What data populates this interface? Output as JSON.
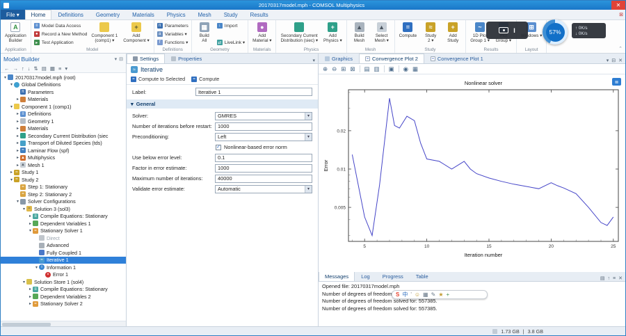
{
  "title_bar": {
    "title": "20170317model.mph - COMSOL Multiphysics",
    "close": "✕"
  },
  "menu": {
    "file_label": "File ▾",
    "tabs": [
      "Home",
      "Definitions",
      "Geometry",
      "Materials",
      "Physics",
      "Mesh",
      "Study",
      "Results"
    ],
    "active_tab": "Home"
  },
  "ribbon": {
    "groups": [
      {
        "label": "Application",
        "items": [
          {
            "type": "big",
            "icon": "app-builder",
            "label": "Application\nBuilder"
          }
        ]
      },
      {
        "label": "Model",
        "items": [
          {
            "type": "small",
            "icon": "model-data",
            "label": "Model Data Access"
          },
          {
            "type": "small",
            "icon": "record",
            "label": "Record a New Method"
          },
          {
            "type": "small",
            "icon": "test-app",
            "label": "Test Application"
          },
          {
            "type": "big",
            "icon": "component",
            "label": "Component 1\n(comp1)",
            "caret": true
          },
          {
            "type": "big",
            "icon": "add-component",
            "label": "Add\nComponent",
            "caret": true
          }
        ]
      },
      {
        "label": "Definitions",
        "items": [
          {
            "type": "small",
            "icon": "pi",
            "label": "Parameters"
          },
          {
            "type": "small",
            "icon": "variables",
            "label": "Variables",
            "caret": true
          },
          {
            "type": "small",
            "icon": "functions",
            "label": "Functions",
            "caret": true
          }
        ]
      },
      {
        "label": "Geometry",
        "items": [
          {
            "type": "big",
            "icon": "build-all",
            "label": "Build\nAll"
          },
          {
            "type": "small",
            "icon": "import",
            "label": "Import"
          },
          {
            "type": "small",
            "icon": "livelink",
            "label": "LiveLink",
            "caret": true
          }
        ]
      },
      {
        "label": "Materials",
        "items": [
          {
            "type": "big",
            "icon": "add-material",
            "label": "Add\nMaterial",
            "caret": true
          }
        ]
      },
      {
        "label": "Physics",
        "items": [
          {
            "type": "big",
            "icon": "siec",
            "label": "Secondary Current\nDistribution (siec)",
            "caret": true
          },
          {
            "type": "big",
            "icon": "add-physics",
            "label": "Add\nPhysics",
            "caret": true
          }
        ]
      },
      {
        "label": "Mesh",
        "items": [
          {
            "type": "big",
            "icon": "build-mesh",
            "label": "Build\nMesh"
          },
          {
            "type": "big",
            "icon": "select-mesh",
            "label": "Select\nMesh",
            "caret": true
          }
        ]
      },
      {
        "label": "Study",
        "items": [
          {
            "type": "big",
            "icon": "compute",
            "label": "Compute"
          },
          {
            "type": "big",
            "icon": "study",
            "label": "Study\n2",
            "caret": true
          },
          {
            "type": "big",
            "icon": "add-study",
            "label": "Add\nStudy"
          }
        ]
      },
      {
        "label": "Results",
        "items": [
          {
            "type": "big",
            "icon": "plot-group",
            "label": "1D Plot\nGroup 1",
            "caret": true
          },
          {
            "type": "big",
            "icon": "plot-group2",
            "label": "Plot\nGroup",
            "caret": true
          }
        ]
      },
      {
        "label": "Layout",
        "items": [
          {
            "type": "big",
            "icon": "windows",
            "label": "Windows",
            "caret": true
          }
        ]
      }
    ]
  },
  "model_builder": {
    "header": "Model Builder",
    "toolbar_icons": [
      "←",
      "→",
      "↑",
      "↓",
      "⇅",
      "▤",
      "▦",
      "≡",
      "▾"
    ],
    "items": [
      {
        "label": "20170317model.mph (root)",
        "indent": 0,
        "arrow": "exp",
        "icon": "model-root"
      },
      {
        "label": "Global Definitions",
        "indent": 1,
        "arrow": "exp",
        "icon": "globe"
      },
      {
        "label": "Parameters",
        "indent": 2,
        "arrow": "none",
        "icon": "pi"
      },
      {
        "label": "Materials",
        "indent": 2,
        "arrow": "col",
        "icon": "materials"
      },
      {
        "label": "Component 1 (comp1)",
        "indent": 1,
        "arrow": "exp",
        "icon": "component"
      },
      {
        "label": "Definitions",
        "indent": 2,
        "arrow": "col",
        "icon": "definitions"
      },
      {
        "label": "Geometry 1",
        "indent": 2,
        "arrow": "col",
        "icon": "geometry"
      },
      {
        "label": "Materials",
        "indent": 2,
        "arrow": "col",
        "icon": "materials"
      },
      {
        "label": "Secondary Current Distribution (siec",
        "indent": 2,
        "arrow": "col",
        "icon": "siec"
      },
      {
        "label": "Transport of Diluted Species (tds)",
        "indent": 2,
        "arrow": "col",
        "icon": "tds"
      },
      {
        "label": "Laminar Flow (spf)",
        "indent": 2,
        "arrow": "col",
        "icon": "spf"
      },
      {
        "label": "Multiphysics",
        "indent": 2,
        "arrow": "col",
        "icon": "multiphysics"
      },
      {
        "label": "Mesh 1",
        "indent": 2,
        "arrow": "col",
        "icon": "mesh"
      },
      {
        "label": "Study 1",
        "indent": 1,
        "arrow": "col",
        "icon": "study"
      },
      {
        "label": "Study 2",
        "indent": 1,
        "arrow": "exp",
        "icon": "study"
      },
      {
        "label": "Step 1: Stationary",
        "indent": 2,
        "arrow": "none",
        "icon": "step"
      },
      {
        "label": "Step 2: Stationary 2",
        "indent": 2,
        "arrow": "none",
        "icon": "step"
      },
      {
        "label": "Solver Configurations",
        "indent": 2,
        "arrow": "exp",
        "icon": "solverconf"
      },
      {
        "label": "Solution 3 (sol3)",
        "indent": 3,
        "arrow": "exp",
        "icon": "solution"
      },
      {
        "label": "Compile Equations: Stationary",
        "indent": 4,
        "arrow": "col",
        "icon": "compile"
      },
      {
        "label": "Dependent Variables 1",
        "indent": 4,
        "arrow": "col",
        "icon": "depvar"
      },
      {
        "label": "Stationary Solver 1",
        "indent": 4,
        "arrow": "exp",
        "icon": "statsolver"
      },
      {
        "label": "Direct",
        "indent": 5,
        "arrow": "none",
        "icon": "direct",
        "dim": true
      },
      {
        "label": "Advanced",
        "indent": 5,
        "arrow": "none",
        "icon": "advanced"
      },
      {
        "label": "Fully Coupled 1",
        "indent": 5,
        "arrow": "none",
        "icon": "fullycoupled"
      },
      {
        "label": "Iterative 1",
        "indent": 5,
        "arrow": "none",
        "icon": "iterative",
        "selected": true
      },
      {
        "label": "Information 1",
        "indent": 5,
        "arrow": "exp",
        "icon": "info"
      },
      {
        "label": "Error 1",
        "indent": 6,
        "arrow": "none",
        "icon": "error"
      },
      {
        "label": "Solution Store 1 (sol4)",
        "indent": 3,
        "arrow": "exp",
        "icon": "solstore"
      },
      {
        "label": "Compile Equations: Stationary",
        "indent": 4,
        "arrow": "col",
        "icon": "compile"
      },
      {
        "label": "Dependent Variables 2",
        "indent": 4,
        "arrow": "col",
        "icon": "depvar"
      },
      {
        "label": "Stationary Solver 2",
        "indent": 4,
        "arrow": "col",
        "icon": "statsolver"
      }
    ]
  },
  "settings": {
    "tabs": [
      "Settings",
      "Properties"
    ],
    "active_tab": "Settings",
    "title": "Iterative",
    "toolbar": {
      "compute_to_selected": "Compute to Selected",
      "compute": "Compute"
    },
    "label_field": {
      "label": "Label:",
      "value": "Iterative 1"
    },
    "section_general": "General",
    "fields": [
      {
        "label": "Solver:",
        "type": "combo",
        "value": "GMRES"
      },
      {
        "label": "Number of iterations before restart:",
        "type": "input",
        "value": "1000"
      },
      {
        "label": "Preconditioning:",
        "type": "combo",
        "value": "Left"
      },
      {
        "label": "Nonlinear-based error norm",
        "type": "checkbox",
        "checked": true
      },
      {
        "label": "Use below error level:",
        "type": "input",
        "value": "0.1"
      },
      {
        "label": "Factor in error estimate:",
        "type": "input",
        "value": "1000"
      },
      {
        "label": "Maximum number of iterations:",
        "type": "input",
        "value": "40000"
      },
      {
        "label": "Validate error estimate:",
        "type": "combo",
        "value": "Automatic"
      }
    ]
  },
  "graphics": {
    "tabs": [
      {
        "label": "Graphics",
        "icon": "graphics-tab"
      },
      {
        "label": "Convergence Plot 2",
        "icon": "conv-tab"
      },
      {
        "label": "Convergence Plot 1",
        "icon": "conv-tab"
      }
    ],
    "active_tab": "Convergence Plot 2",
    "strip_icons": [
      "▾",
      "⊟",
      "✕"
    ],
    "toolbar_icons": [
      "⊕",
      "⊖",
      "⊞",
      "⊠",
      "|",
      "▤",
      "▥",
      "|",
      "▣",
      "|",
      "◉",
      "▦"
    ]
  },
  "chart_data": {
    "type": "line",
    "title": "Nonlinear solver",
    "xlabel": "Iteration number",
    "ylabel": "Error",
    "x_ticks": [
      5,
      10,
      15,
      20,
      25
    ],
    "y_ticks": [
      0.02,
      0.01,
      0.005
    ],
    "y_scale": "log",
    "x_range": [
      3.7,
      25.4
    ],
    "y_range": [
      0.0027,
      0.042
    ],
    "grid": false,
    "legend": "none",
    "line_color": "#4545c8",
    "x": [
      4,
      5,
      5.6,
      6.2,
      7,
      7.4,
      7.8,
      8.4,
      9,
      9.5,
      10,
      11,
      12,
      13,
      13.5,
      14,
      15,
      16,
      17,
      18,
      19,
      20,
      20.5,
      21,
      22,
      23,
      24,
      24.5,
      25
    ],
    "y": [
      0.013,
      0.0042,
      0.003,
      0.0075,
      0.036,
      0.022,
      0.021,
      0.026,
      0.024,
      0.016,
      0.012,
      0.0115,
      0.01,
      0.0115,
      0.01,
      0.0092,
      0.0085,
      0.008,
      0.0076,
      0.0073,
      0.007,
      0.0078,
      0.0074,
      0.0071,
      0.0064,
      0.005,
      0.0038,
      0.0036,
      0.0042
    ]
  },
  "messages": {
    "tabs": [
      "Messages",
      "Log",
      "Progress",
      "Table"
    ],
    "active_tab": "Messages",
    "strip_icons": [
      "▤",
      "↑",
      "≡",
      "✕"
    ],
    "lines": [
      "Opened file: 20170317model.mph",
      "Number of degrees of freedom solved for: 557385.",
      "Number of degrees of freedom solved for: 557385.",
      "Number of degrees of freedom solved for: 557385."
    ]
  },
  "status_bar": {
    "memory_physical": "1.73 GB",
    "separator": "|",
    "memory_virtual": "3.8 GB"
  },
  "overlay": {
    "recorder_label": "I",
    "gauge_percent": "57%",
    "net_up": "↑ 0K/s",
    "net_down": "↓ 0K/s",
    "sogou": [
      {
        "glyph": "S",
        "color": "#e8442f"
      },
      {
        "glyph": "中",
        "color": "#2f6fc0"
      },
      {
        "glyph": "'",
        "color": "#888888"
      },
      {
        "glyph": "☺",
        "color": "#c09a2f"
      },
      {
        "glyph": "▦",
        "color": "#6a7a8a"
      },
      {
        "glyph": "✎",
        "color": "#6a7a8a"
      },
      {
        "glyph": "★",
        "color": "#c09a2f"
      },
      {
        "glyph": "+",
        "color": "#3f8f4f"
      }
    ]
  },
  "icons": {
    "app-builder": {
      "glyph": "A",
      "bg": "#ffffff",
      "fg": "#2f8f3f",
      "border": true
    },
    "model-data": {
      "glyph": "≡",
      "bg": "#5b8fd0"
    },
    "record": {
      "glyph": "●",
      "bg": "#c03a3a"
    },
    "test-app": {
      "glyph": "▸",
      "bg": "#3f8f4f"
    },
    "component": {
      "bg": "#ecc94b"
    },
    "add-component": {
      "glyph": "+",
      "bg": "#ecc94b",
      "fg": "#553"
    },
    "pi": {
      "glyph": "π",
      "bg": "#3a6fb0"
    },
    "variables": {
      "glyph": "a",
      "bg": "#6a8fc0"
    },
    "functions": {
      "glyph": "f",
      "bg": "#7a9ad0"
    },
    "build-all": {
      "glyph": "▦",
      "bg": "#8fa3b8"
    },
    "import": {
      "glyph": "↓",
      "bg": "#4a86c8"
    },
    "livelink": {
      "glyph": "⇄",
      "bg": "#3fa0a0"
    },
    "add-material": {
      "glyph": "●",
      "bg": "#b06ac0"
    },
    "siec": {
      "bg": "#2fa089"
    },
    "add-physics": {
      "glyph": "+",
      "bg": "#2fa089"
    },
    "build-mesh": {
      "glyph": "▲",
      "bg": "#aab4be",
      "fg": "#4a5560"
    },
    "select-mesh": {
      "glyph": "▲",
      "bg": "#c8d0d8",
      "fg": "#4a5560"
    },
    "compute": {
      "glyph": "=",
      "bg": "#2f6fc0"
    },
    "study": {
      "glyph": "≈",
      "bg": "#c9a227"
    },
    "add-study": {
      "glyph": "+",
      "bg": "#c9a227"
    },
    "plot-group": {
      "glyph": "~",
      "bg": "#4a86c8"
    },
    "plot-group2": {
      "glyph": "~",
      "bg": "#4a86c8"
    },
    "windows": {
      "glyph": "⊞",
      "bg": "#5b8fd0"
    },
    "model-root": {
      "bg": "#4a86c8"
    },
    "globe": {
      "bg": "#3fa0d0",
      "round": true
    },
    "materials": {
      "bg": "#cf7f3a"
    },
    "definitions": {
      "glyph": "≡",
      "bg": "#5b8fd0"
    },
    "geometry": {
      "bg": "#b5bdc6"
    },
    "tds": {
      "bg": "#46a0c8"
    },
    "spf": {
      "glyph": "≈",
      "bg": "#3f7fc0"
    },
    "multiphysics": {
      "glyph": "▲",
      "bg": "#d06f2f"
    },
    "mesh": {
      "glyph": "▲",
      "bg": "#c8cfd6",
      "fg": "#5a6570"
    },
    "step": {
      "glyph": "=",
      "bg": "#d9a440"
    },
    "solverconf": {
      "bg": "#8898a8"
    },
    "solution": {
      "glyph": "=",
      "bg": "#e0b84a",
      "fg": "#665"
    },
    "compile": {
      "glyph": "≡",
      "bg": "#4aa8a0"
    },
    "depvar": {
      "bg": "#57a857"
    },
    "statsolver": {
      "glyph": "=",
      "bg": "#e09a3a"
    },
    "direct": {
      "bg": "#c0c6cc"
    },
    "advanced": {
      "bg": "#a8b0b8"
    },
    "fullycoupled": {
      "bg": "#4a78c8"
    },
    "iterative": {
      "glyph": "≈",
      "bg": "#4a9ad0"
    },
    "info": {
      "glyph": "i",
      "bg": "#3a85d0",
      "round": true
    },
    "error": {
      "glyph": "×",
      "bg": "#d03030",
      "round": true
    },
    "solstore": {
      "bg": "#d8c04a"
    },
    "graphics-tab": {
      "bg": "#b8cade"
    },
    "conv-tab": {
      "glyph": "≈",
      "bg": "#ffffff",
      "fg": "#3a5fc0",
      "border": true
    },
    "settings-tab": {
      "bg": "#8a98a8"
    },
    "properties-tab": {
      "bg": "#b8c2cc"
    }
  }
}
